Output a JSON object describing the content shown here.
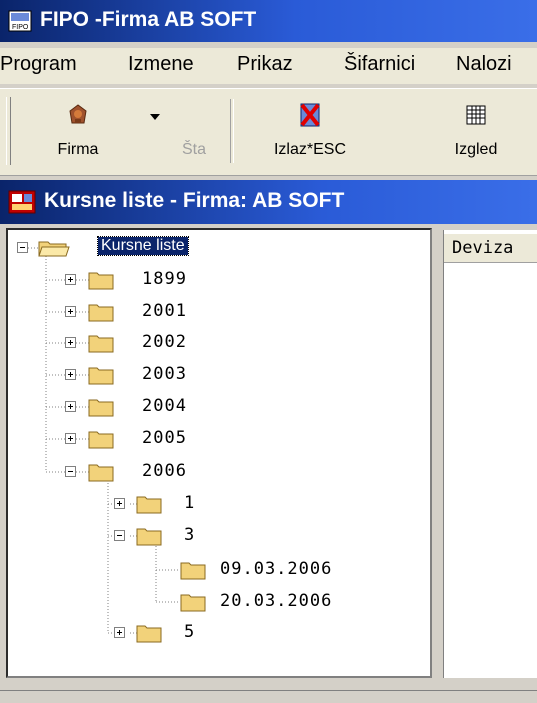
{
  "app": {
    "title": "FIPO -Firma AB SOFT"
  },
  "menu": [
    "Program",
    "Izmene",
    "Prikaz",
    "Šifarnici",
    "Nalozi"
  ],
  "toolbar": {
    "firma": "Firma",
    "sta": "Šta",
    "izlaz": "Izlaz*ESC",
    "izgled": "Izgled"
  },
  "child": {
    "title": "Kursne liste - Firma: AB SOFT"
  },
  "tree": {
    "root": "Kursne liste",
    "years": [
      "1899",
      "2001",
      "2002",
      "2003",
      "2004",
      "2005",
      "2006"
    ],
    "months": [
      "1",
      "3",
      "5"
    ],
    "dates": [
      "09.03.2006",
      "20.03.2006"
    ]
  },
  "grid": {
    "column": "Deviza"
  }
}
